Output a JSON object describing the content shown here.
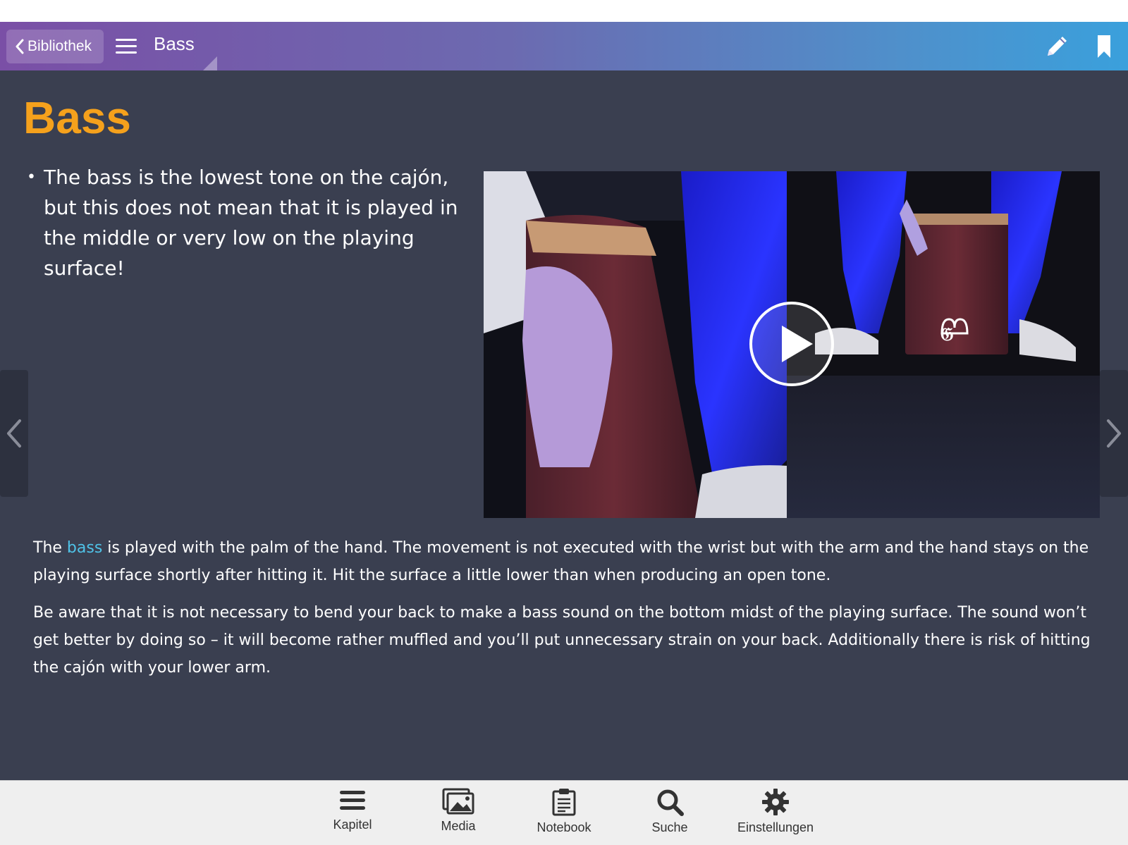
{
  "header": {
    "back_label": "Bibliothek",
    "title": "Bass"
  },
  "page": {
    "title": "Bass",
    "bullets": [
      "The bass is the lowest tone on the cajón, but this does not mean that it is played in the middle or very low on the playing surface!"
    ],
    "para1": {
      "before": "The ",
      "link": "bass",
      "after": " is played with the palm of the hand. The movement is not executed with the wrist but with the arm and the hand stays on the playing surface shortly after hitting it. Hit the surface a little lower than when producing an open tone."
    },
    "para2": "Be aware that it is not necessary to bend your back to make a bass sound on the bottom midst of the playing surface. The sound won’t get better by doing so – it will become rather muffled and you’ll put unnecessary strain on your back. Additionally there is risk of hitting the cajón with your lower arm."
  },
  "tabbar": {
    "items": [
      {
        "label": "Kapitel",
        "icon": "list-icon"
      },
      {
        "label": "Media",
        "icon": "images-icon"
      },
      {
        "label": "Notebook",
        "icon": "clipboard-icon"
      },
      {
        "label": "Suche",
        "icon": "search-icon"
      },
      {
        "label": "Einstellungen",
        "icon": "gear-icon"
      }
    ]
  },
  "colors": {
    "accent_title": "#f5a11c",
    "link": "#4fc3e8",
    "content_bg": "#3a3f50"
  }
}
